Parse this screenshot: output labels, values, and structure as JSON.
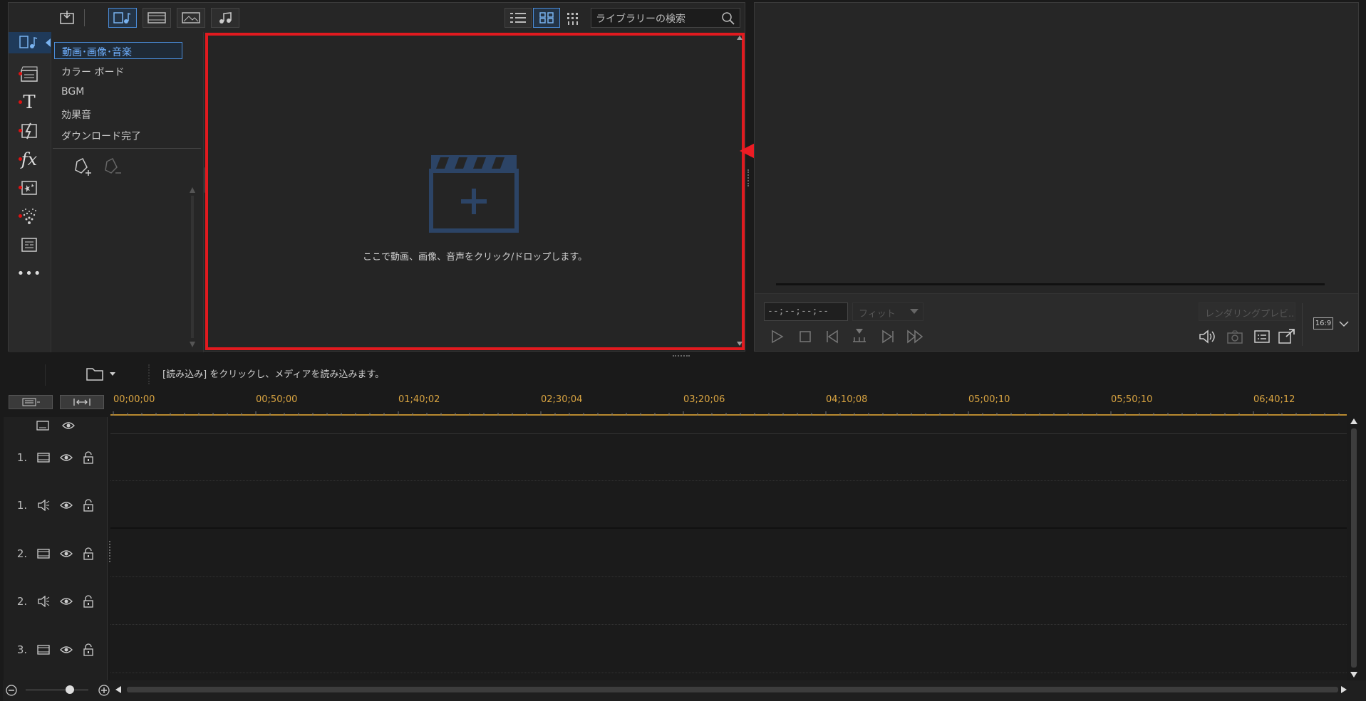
{
  "library": {
    "categories": [
      "動画･画像･音楽",
      "カラー ボード",
      "BGM",
      "効果音",
      "ダウンロード完了"
    ],
    "search_placeholder": "ライブラリーの検索",
    "drop_hint": "ここで動画、画像、音声をクリック/ドロップします。"
  },
  "preview": {
    "timecode": "--;--;--;--",
    "fit_label": "フィット",
    "render_label": "レンダリングプレビ...",
    "aspect": "16:9"
  },
  "status": {
    "message": "[読み込み] をクリックし、メディアを読み込みます。"
  },
  "timeline": {
    "ruler": [
      "00;00;00",
      "00;50;00",
      "01;40;02",
      "02;30;04",
      "03;20;06",
      "04;10;08",
      "05;00;10",
      "05;50;10",
      "06;40;12"
    ],
    "tracks": [
      {
        "num": "1.",
        "kind": "video"
      },
      {
        "num": "1.",
        "kind": "audio"
      },
      {
        "num": "2.",
        "kind": "video"
      },
      {
        "num": "2.",
        "kind": "audio"
      },
      {
        "num": "3.",
        "kind": "video"
      }
    ]
  },
  "colors": {
    "accent": "#4a8cd9",
    "annotation_red": "#e11a1f",
    "ruler_text": "#d9a441"
  }
}
